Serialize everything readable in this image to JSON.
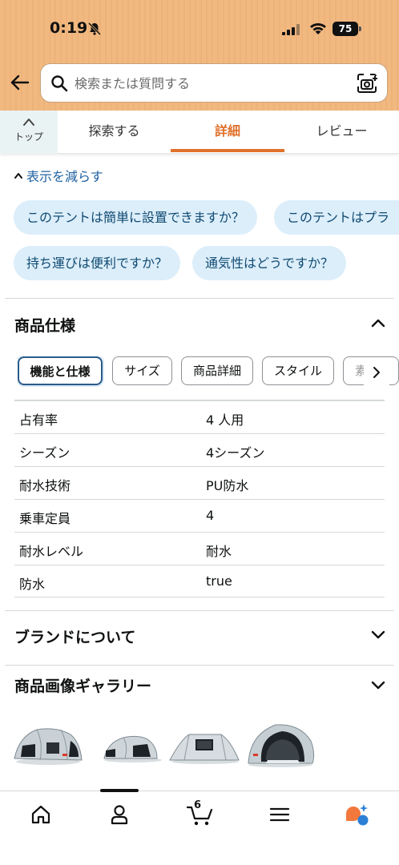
{
  "status_bar": {
    "time": "0:19",
    "battery": "75"
  },
  "search": {
    "placeholder": "検索または質問する"
  },
  "tabs": [
    {
      "label": "トップ"
    },
    {
      "label": "探索する"
    },
    {
      "label": "詳細",
      "active": true
    },
    {
      "label": "レビュー"
    }
  ],
  "questions": {
    "less_label": "表示を減らす",
    "chips": [
      "このテントは簡単に設置できますか？",
      "このテントはプラ",
      "持ち運びは便利ですか？",
      "通気性はどうですか？"
    ]
  },
  "specs": {
    "title": "商品仕様",
    "tabs": [
      "機能と仕様",
      "サイズ",
      "商品詳細",
      "スタイル",
      "素材"
    ],
    "rows": [
      {
        "key": "占有率",
        "value": "4 人用"
      },
      {
        "key": "シーズン",
        "value": "4シーズン"
      },
      {
        "key": "耐水技術",
        "value": "PU防水"
      },
      {
        "key": "乗車定員",
        "value": "4"
      },
      {
        "key": "耐水レベル",
        "value": "耐水"
      },
      {
        "key": "防水",
        "value": "true"
      }
    ]
  },
  "brand": {
    "title": "ブランドについて"
  },
  "gallery": {
    "title": "商品画像ギャラリー"
  },
  "bottom_nav": {
    "cart_count": "6"
  },
  "colors": {
    "accent": "#e0712c",
    "link": "#2162a1",
    "chip_bg": "#dceefa",
    "header_bg": "#f1b980"
  }
}
